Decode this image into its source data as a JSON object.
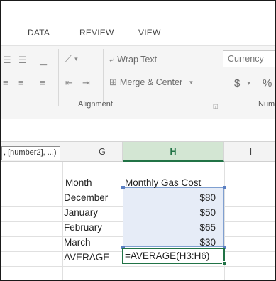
{
  "ribbon_tabs": [
    "DATA",
    "REVIEW",
    "VIEW"
  ],
  "ribbon": {
    "wrap_text": "Wrap Text",
    "merge_center": "Merge & Center",
    "number_format": "Currency",
    "currency_symbol": "$",
    "percent_symbol": "%",
    "alignment_group": "Alignment",
    "number_group": "Num"
  },
  "tooltip": ", [number2], ...)",
  "columns": {
    "g": "G",
    "h": "H",
    "i": "I"
  },
  "cells": {
    "header_label": "Month",
    "header_value": "Monthly Gas Cost",
    "rows": [
      {
        "month": "December",
        "cost": "$80"
      },
      {
        "month": "January",
        "cost": "$50"
      },
      {
        "month": "February",
        "cost": "$65"
      },
      {
        "month": "March",
        "cost": "$30"
      }
    ],
    "average_label": "AVERAGE",
    "formula": "=AVERAGE(H3:H6)"
  },
  "colors": {
    "selected_column": "#217346",
    "selection_fill": "#e6ecf7",
    "selection_border": "#7f9fd0"
  }
}
